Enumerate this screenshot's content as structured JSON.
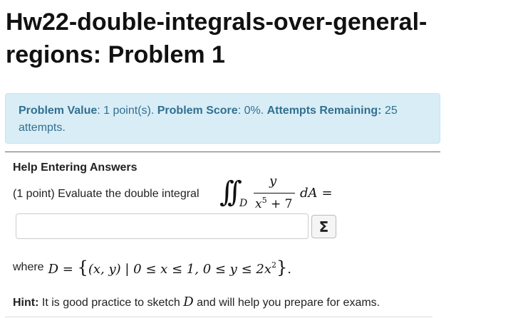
{
  "page": {
    "title": "Hw22-double-integrals-over-general-regions: Problem 1"
  },
  "problem_info": {
    "value_label": "Problem Value",
    "value_text": ": 1 point(s). ",
    "score_label": "Problem Score",
    "score_text": ": 0%. ",
    "attempts_label": "Attempts Remaining:",
    "attempts_text": " 25 attempts."
  },
  "help": {
    "link_label": "Help Entering Answers"
  },
  "problem": {
    "prefix": "(1 point) Evaluate the double integral",
    "integral_region": "D",
    "numerator": "y",
    "denominator_base": "x",
    "denominator_exp": "5",
    "denominator_rest": " + 7",
    "differential": "dA",
    "equals": "="
  },
  "answer": {
    "value": "",
    "placeholder": "",
    "equation_editor_label": "Σ"
  },
  "region": {
    "where_text": "where",
    "definition_prefix": "D = ",
    "set_open": "{",
    "set_body_1": "(x, y) | 0 ≤ x ≤ 1,  0 ≤ y ≤ 2x",
    "set_exp": "2",
    "set_close": "}",
    "end_punct": "."
  },
  "hint": {
    "label": "Hint:",
    "text_before": " It is good practice to sketch ",
    "symbol": "D",
    "text_after": " and will help you prepare for exams."
  },
  "colors": {
    "info_bg": "#d9edf7",
    "info_text": "#31708f",
    "info_border": "#bce8f1"
  }
}
